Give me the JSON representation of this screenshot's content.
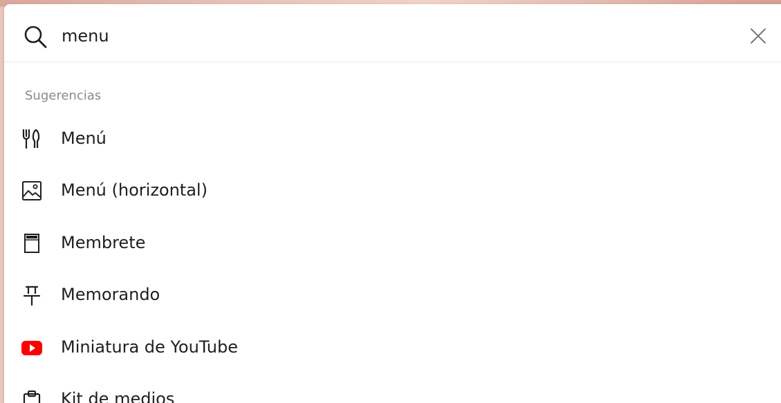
{
  "search": {
    "query": "menu",
    "icon": "search-icon",
    "clear_icon": "close-icon"
  },
  "suggestions": {
    "heading": "Sugerencias",
    "items": [
      {
        "label": "Menú",
        "icon": "utensils-icon"
      },
      {
        "label": "Menú (horizontal)",
        "icon": "image-icon"
      },
      {
        "label": "Membrete",
        "icon": "letterhead-icon"
      },
      {
        "label": "Memorando",
        "icon": "pushpin-icon"
      },
      {
        "label": "Miniatura de YouTube",
        "icon": "youtube-icon"
      },
      {
        "label": "Kit de medios",
        "icon": "clipboard-icon"
      }
    ]
  },
  "colors": {
    "youtube_red": "#ff0000",
    "text": "#1e1e1e",
    "muted": "#8a8a8a"
  }
}
